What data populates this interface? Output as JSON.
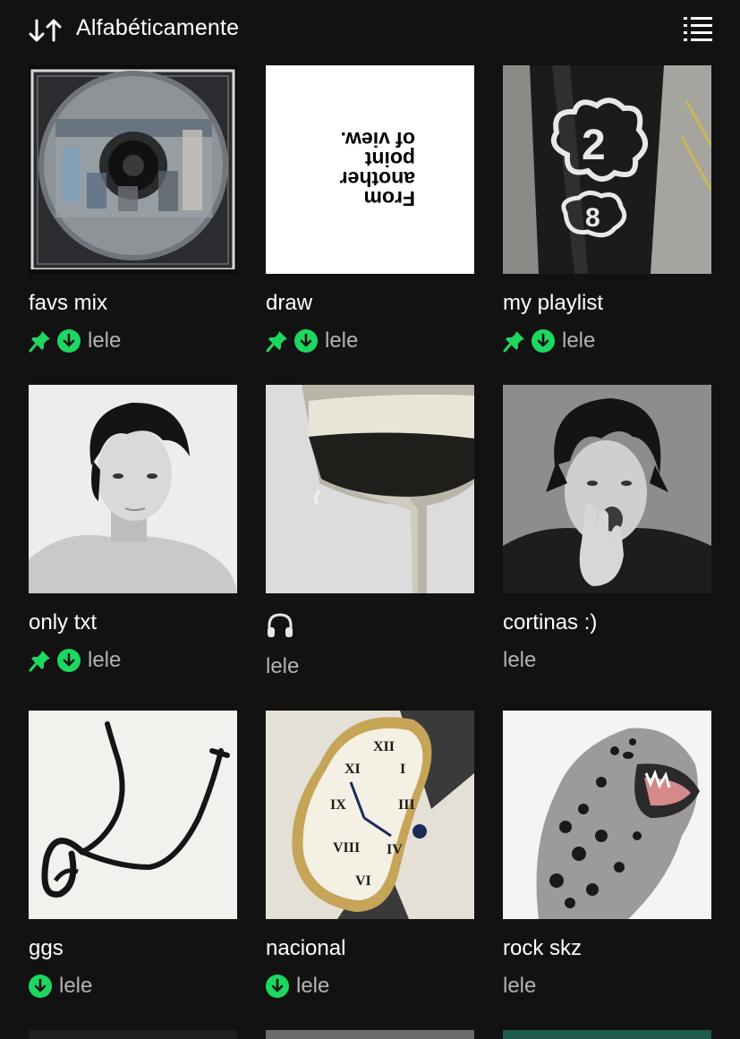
{
  "header": {
    "sort_label": "Alfabéticamente",
    "sort_icon": "sort-up-down-icon",
    "view_icon": "list-view-icon"
  },
  "colors": {
    "background": "#121212",
    "accent_green": "#1ed760",
    "secondary_text": "#b3b3b3"
  },
  "playlists": [
    {
      "title": "favs mix",
      "owner": "lele",
      "pinned": true,
      "downloaded": true,
      "cover": "cd-case-group-photo"
    },
    {
      "title": "draw",
      "owner": "lele",
      "pinned": true,
      "downloaded": true,
      "cover": "upside-down-text",
      "cover_text": [
        "From",
        "another",
        "point",
        "of view."
      ]
    },
    {
      "title": "my playlist",
      "owner": "lele",
      "pinned": true,
      "downloaded": true,
      "cover": "graffiti-post"
    },
    {
      "title": "only txt",
      "owner": "lele",
      "pinned": true,
      "downloaded": true,
      "cover": "bw-portrait"
    },
    {
      "title": "🎧",
      "owner": "lele",
      "pinned": false,
      "downloaded": false,
      "cover": "champagne-glass"
    },
    {
      "title": "cortinas :)",
      "owner": "lele",
      "pinned": false,
      "downloaded": false,
      "cover": "bw-portrait-hand"
    },
    {
      "title": "ggs",
      "owner": "lele",
      "pinned": false,
      "downloaded": true,
      "cover": "black-ribbon"
    },
    {
      "title": "nacional",
      "owner": "lele",
      "pinned": false,
      "downloaded": true,
      "cover": "melting-watch"
    },
    {
      "title": "rock skz",
      "owner": "lele",
      "pinned": false,
      "downloaded": false,
      "cover": "roaring-leopard"
    }
  ]
}
